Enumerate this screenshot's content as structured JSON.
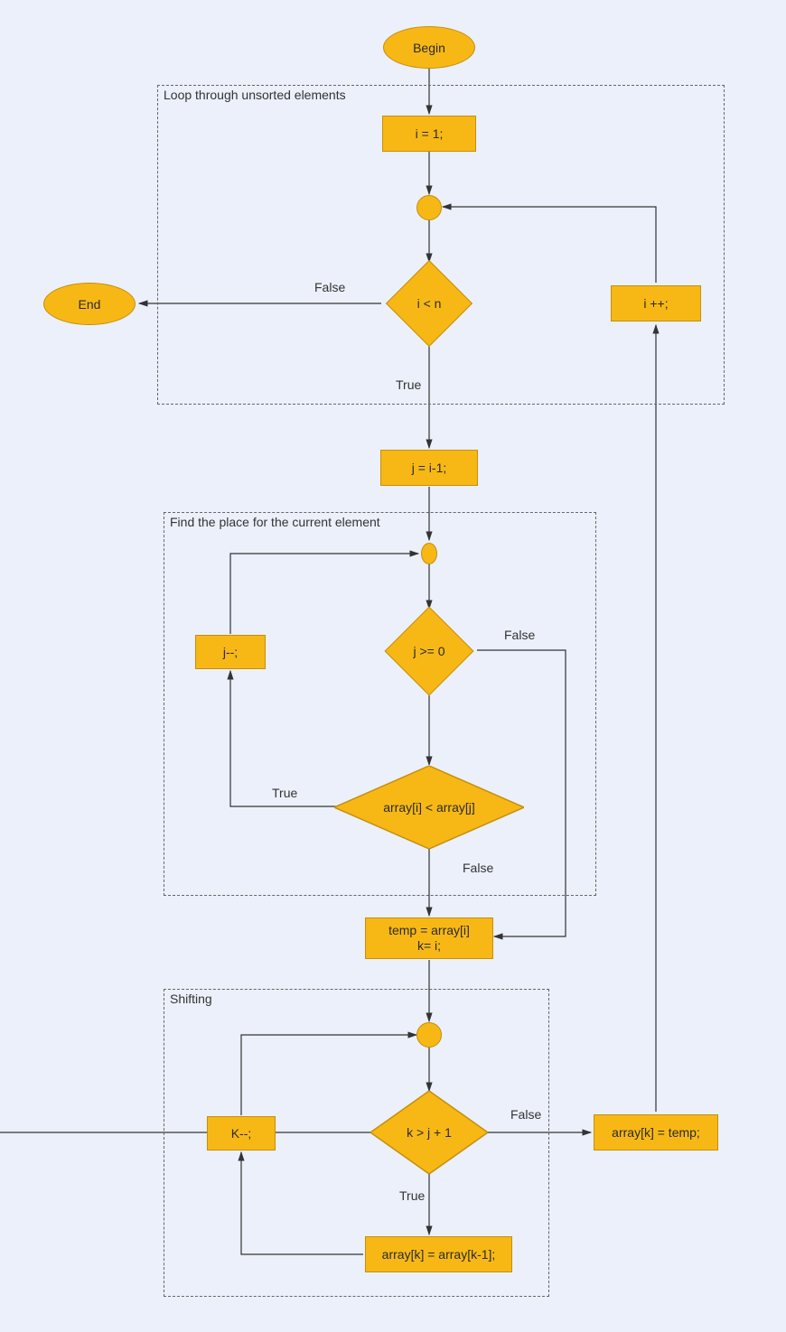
{
  "nodes": {
    "begin": "Begin",
    "end": "End",
    "i_init": "i = 1;",
    "i_cond": "i < n",
    "i_inc": "i ++;",
    "j_init": "j = i-1;",
    "j_cond": "j >= 0",
    "j_dec": "j--;",
    "compare": "array[i] < array[j]",
    "temp_line1": "temp = array[i]",
    "temp_line2": "k= i;",
    "k_cond": "k > j + 1",
    "k_dec": "K--;",
    "shift": "array[k] = array[k-1];",
    "assign": "array[k] = temp;"
  },
  "groups": {
    "outer": "Loop through unsorted elements",
    "inner": "Find the place for the current element",
    "shifting": "Shifting"
  },
  "labels": {
    "true": "True",
    "false": "False"
  }
}
